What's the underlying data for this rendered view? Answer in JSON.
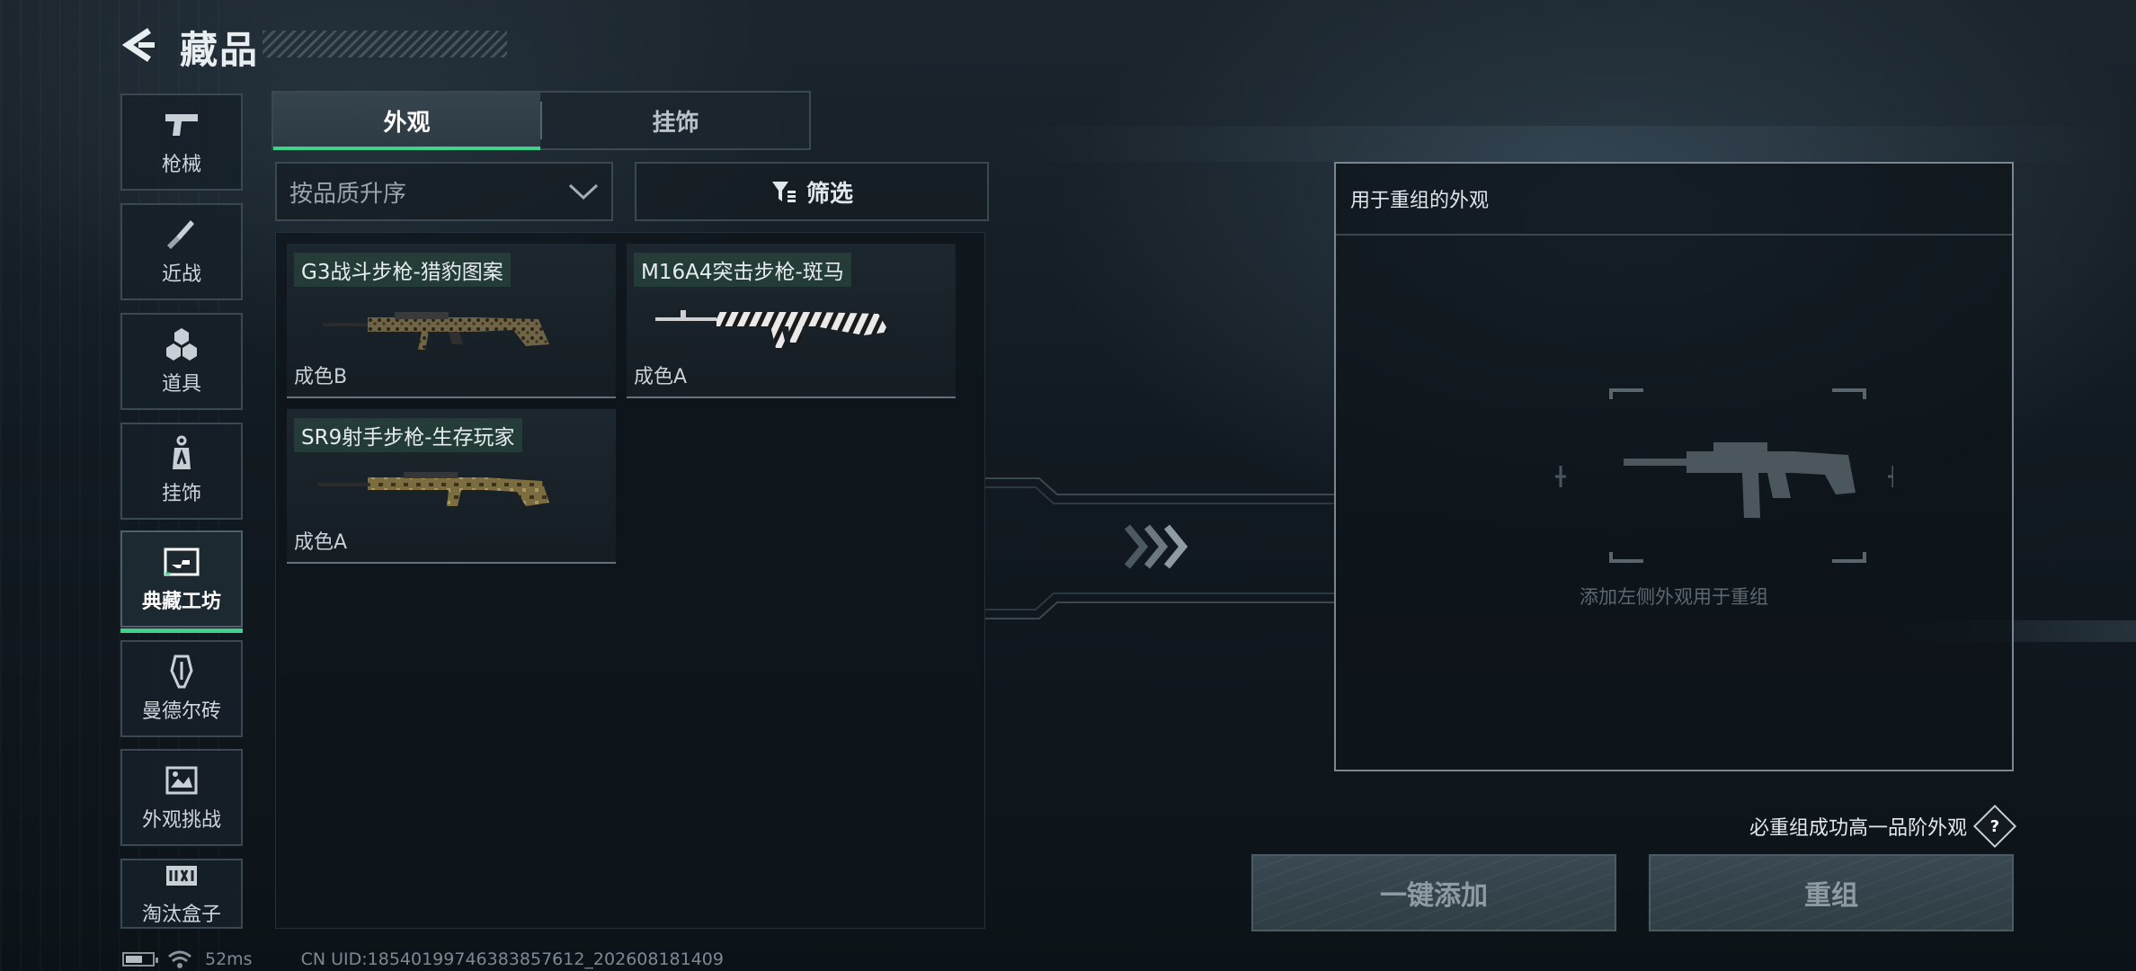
{
  "header": {
    "title": "藏品",
    "back_icon": "back-arrow-icon"
  },
  "sidebar": {
    "items": [
      {
        "label": "枪械",
        "icon": "pistol-icon",
        "active": false
      },
      {
        "label": "近战",
        "icon": "knife-icon",
        "active": false
      },
      {
        "label": "道具",
        "icon": "hexagon-cluster-icon",
        "active": false
      },
      {
        "label": "挂饰",
        "icon": "charm-tag-icon",
        "active": false
      },
      {
        "label": "典藏工坊",
        "icon": "workshop-icon",
        "active": true
      },
      {
        "label": "曼德尔砖",
        "icon": "mandel-brick-icon",
        "active": false
      },
      {
        "label": "外观挑战",
        "icon": "challenge-image-icon",
        "active": false
      },
      {
        "label": "淘汰盒子",
        "icon": "box-logo-icon",
        "active": false
      }
    ]
  },
  "tabs": [
    {
      "label": "外观",
      "active": true
    },
    {
      "label": "挂饰",
      "active": false
    }
  ],
  "sort": {
    "selected": "按品质升序"
  },
  "filter": {
    "label": "筛选"
  },
  "items": [
    {
      "name": "G3战斗步枪-猎豹图案",
      "grade": "成色B",
      "skin": "leopard",
      "accent": "#8a7a52"
    },
    {
      "name": "M16A4突击步枪-斑马",
      "grade": "成色A",
      "skin": "zebra",
      "accent": "#e8e8e8"
    },
    {
      "name": "SR9射手步枪-生存玩家",
      "grade": "成色A",
      "skin": "camo",
      "accent": "#8c7a48"
    }
  ],
  "target": {
    "header": "用于重组的外观",
    "hint": "添加左侧外观用于重组"
  },
  "guarantee": {
    "text": "必重组成功高一品阶外观",
    "help_label": "?"
  },
  "buttons": {
    "quick_add": "一键添加",
    "recombine": "重组"
  },
  "status": {
    "ping": "52ms",
    "uid": "CN UID:18540199746383857612_202608181409",
    "battery_level": 0.65
  },
  "colors": {
    "accent_green": "#3fd38a"
  }
}
